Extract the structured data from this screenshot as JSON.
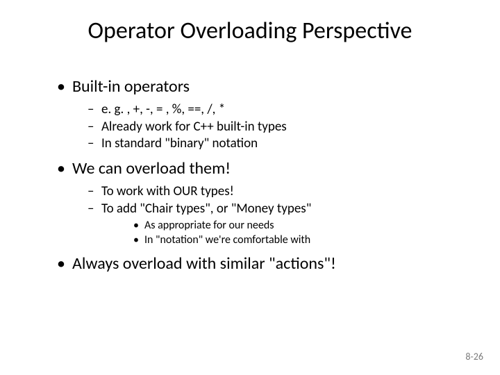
{
  "title": "Operator Overloading Perspective",
  "bullets": [
    {
      "text": "Built-in operators",
      "children": [
        {
          "text": "e. g. , +, -, = , %, ==,  /, *"
        },
        {
          "text": "Already work for C++ built-in types"
        },
        {
          "text": "In standard \"binary\" notation"
        }
      ]
    },
    {
      "text": "We can overload them!",
      "children": [
        {
          "text": "To work with OUR types!"
        },
        {
          "text": "To add \"Chair types\", or \"Money types\"",
          "children": [
            {
              "text": "As appropriate for our needs"
            },
            {
              "text": "In \"notation\" we're comfortable with"
            }
          ]
        }
      ]
    },
    {
      "text": "Always overload with similar \"actions\"!"
    }
  ],
  "page_number": "8-26"
}
